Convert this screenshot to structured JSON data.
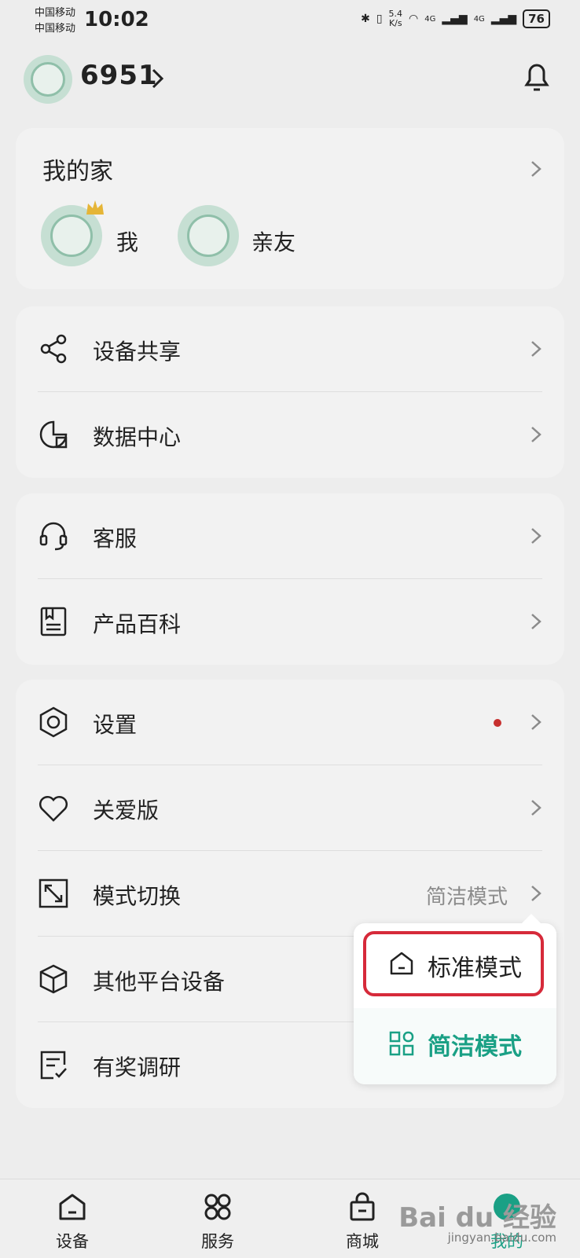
{
  "status_bar": {
    "carrier_1": "中国移动",
    "carrier_2": "中国移动",
    "time": "10:02",
    "speed_value": "5.4",
    "speed_unit": "K/s",
    "net_1": "4G",
    "net_2": "4G",
    "battery": "76"
  },
  "header": {
    "user_id": "6951"
  },
  "family": {
    "title": "我的家",
    "members": [
      {
        "label": "我"
      },
      {
        "label": "亲友"
      }
    ]
  },
  "menu": {
    "share": "设备共享",
    "data_center": "数据中心",
    "service": "客服",
    "wiki": "产品百科",
    "settings": "设置",
    "care": "关爱版",
    "mode_switch": "模式切换",
    "mode_switch_value": "简洁模式",
    "other_devices": "其他平台设备",
    "survey": "有奖调研"
  },
  "mode_popup": {
    "standard": "标准模式",
    "simple": "简洁模式"
  },
  "tabbar": {
    "tabs": [
      {
        "label": "设备"
      },
      {
        "label": "服务"
      },
      {
        "label": "商城"
      },
      {
        "label": "我的"
      }
    ]
  },
  "watermark": {
    "brand": "Bai du 经验",
    "url": "jingyan.baidu.com"
  },
  "colors": {
    "accent": "#1aa085",
    "highlight_border": "#d62a3a",
    "badge_dot": "#c7302f"
  }
}
